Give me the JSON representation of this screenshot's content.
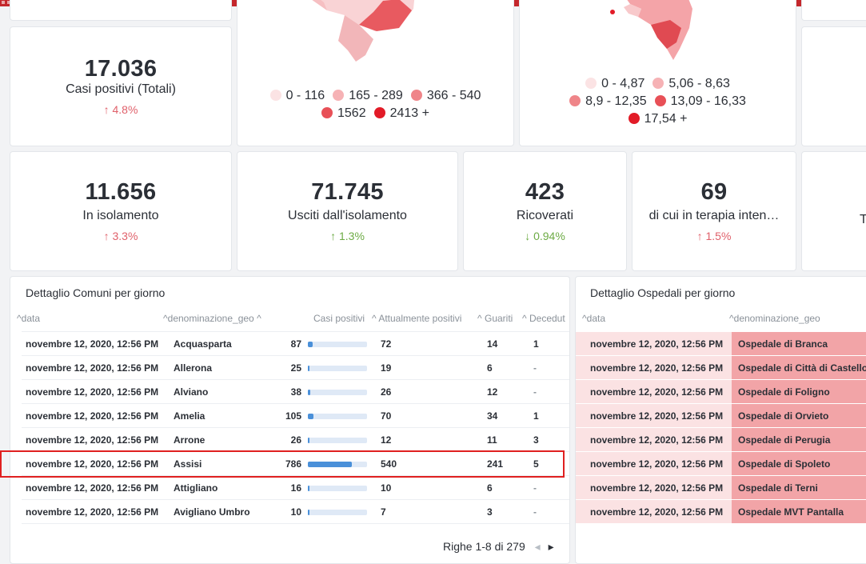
{
  "kpis_top": {
    "casi_totali": {
      "value": "17.036",
      "label": "Casi positivi (Totali)",
      "change": "↑ 4.8%"
    }
  },
  "map1": {
    "legend": [
      {
        "label": "0 - 116",
        "color": "#fbe3e4"
      },
      {
        "label": "165 - 289",
        "color": "#f6b2b5"
      },
      {
        "label": "366 - 540",
        "color": "#ef8589"
      },
      {
        "label": "1562",
        "color": "#e85057"
      },
      {
        "label": "2413 +",
        "color": "#e21b27"
      }
    ]
  },
  "map2": {
    "legend": [
      {
        "label": "0 - 4,87",
        "color": "#fbe3e4"
      },
      {
        "label": "5,06 - 8,63",
        "color": "#f6b2b5"
      },
      {
        "label": "8,9 - 12,35",
        "color": "#ef8589"
      },
      {
        "label": "13,09 - 16,33",
        "color": "#e85057"
      },
      {
        "label": "17,54 +",
        "color": "#e21b27"
      }
    ]
  },
  "kpis_row2": [
    {
      "value": "11.656",
      "label": "In isolamento",
      "change": "↑ 3.3%",
      "dir": "up"
    },
    {
      "value": "71.745",
      "label": "Usciti dall'isolamento",
      "change": "↑ 1.3%",
      "dir": "green"
    },
    {
      "value": "423",
      "label": "Ricoverati",
      "change": "↓ 0.94%",
      "dir": "green"
    },
    {
      "value": "69",
      "label": "di cui in terapia inten…",
      "change": "↑ 1.5%",
      "dir": "up"
    },
    {
      "value": "",
      "label": "T",
      "change": "",
      "dir": "up"
    }
  ],
  "comuni": {
    "title": "Dettaglio Comuni per giorno",
    "headers": [
      "data",
      "denominazione_geo",
      "Casi positivi",
      "Attualmente positivi",
      "Guariti",
      "Decedut"
    ],
    "rows": [
      {
        "data": "novembre 12, 2020, 12:56 PM",
        "geo": "Acquasparta",
        "casi": "87",
        "casi_n": 87,
        "att": "72",
        "guar": "14",
        "dec": "1"
      },
      {
        "data": "novembre 12, 2020, 12:56 PM",
        "geo": "Allerona",
        "casi": "25",
        "casi_n": 25,
        "att": "19",
        "guar": "6",
        "dec": "-"
      },
      {
        "data": "novembre 12, 2020, 12:56 PM",
        "geo": "Alviano",
        "casi": "38",
        "casi_n": 38,
        "att": "26",
        "guar": "12",
        "dec": "-"
      },
      {
        "data": "novembre 12, 2020, 12:56 PM",
        "geo": "Amelia",
        "casi": "105",
        "casi_n": 105,
        "att": "70",
        "guar": "34",
        "dec": "1"
      },
      {
        "data": "novembre 12, 2020, 12:56 PM",
        "geo": "Arrone",
        "casi": "26",
        "casi_n": 26,
        "att": "12",
        "guar": "11",
        "dec": "3"
      },
      {
        "data": "novembre 12, 2020, 12:56 PM",
        "geo": "Assisi",
        "casi": "786",
        "casi_n": 786,
        "att": "540",
        "guar": "241",
        "dec": "5"
      },
      {
        "data": "novembre 12, 2020, 12:56 PM",
        "geo": "Attigliano",
        "casi": "16",
        "casi_n": 16,
        "att": "10",
        "guar": "6",
        "dec": "-"
      },
      {
        "data": "novembre 12, 2020, 12:56 PM",
        "geo": "Avigliano Umbro",
        "casi": "10",
        "casi_n": 10,
        "att": "7",
        "guar": "3",
        "dec": "-"
      }
    ],
    "pager": "Righe 1-8 di 279"
  },
  "ospedali": {
    "title": "Dettaglio Ospedali per giorno",
    "headers": [
      "data",
      "denominazione_geo"
    ],
    "rows": [
      {
        "data": "novembre 12, 2020, 12:56 PM",
        "geo": "Ospedale di Branca"
      },
      {
        "data": "novembre 12, 2020, 12:56 PM",
        "geo": "Ospedale di Città di Castello"
      },
      {
        "data": "novembre 12, 2020, 12:56 PM",
        "geo": "Ospedale di Foligno"
      },
      {
        "data": "novembre 12, 2020, 12:56 PM",
        "geo": "Ospedale di Orvieto"
      },
      {
        "data": "novembre 12, 2020, 12:56 PM",
        "geo": "Ospedale di Perugia"
      },
      {
        "data": "novembre 12, 2020, 12:56 PM",
        "geo": "Ospedale di Spoleto"
      },
      {
        "data": "novembre 12, 2020, 12:56 PM",
        "geo": "Ospedale di Terni"
      },
      {
        "data": "novembre 12, 2020, 12:56 PM",
        "geo": "Ospedale MVT Pantalla"
      }
    ]
  },
  "colors": {
    "accent_red": "#c4272c",
    "up": "#e0616b",
    "down": "#6dab45",
    "bar": "#4a90d9"
  }
}
